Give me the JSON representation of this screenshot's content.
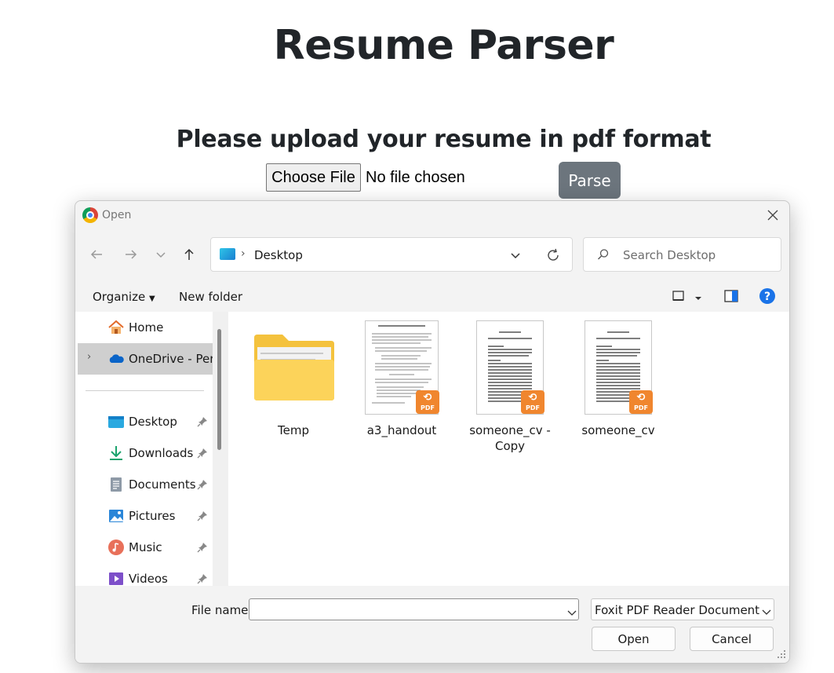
{
  "page": {
    "title": "Resume Parser",
    "upload_heading": "Please upload your resume in pdf format",
    "choose_file_label": "Choose File",
    "no_file_text": "No file chosen",
    "parse_label": "Parse"
  },
  "dialog": {
    "title": "Open",
    "address": {
      "crumb": "Desktop"
    },
    "search": {
      "placeholder": "Search Desktop"
    },
    "toolbar": {
      "organize": "Organize",
      "new_folder": "New folder"
    },
    "sidebar": {
      "home": "Home",
      "onedrive": "OneDrive - Personal",
      "desktop": "Desktop",
      "downloads": "Downloads",
      "documents": "Documents",
      "pictures": "Pictures",
      "music": "Music",
      "videos": "Videos"
    },
    "files": {
      "temp": "Temp",
      "a3": "a3_handout",
      "cv_copy": "someone_cv - Copy",
      "cv": "someone_cv"
    },
    "pdf_badge": "PDF",
    "footer": {
      "file_name_label": "File name:",
      "file_name_value": "",
      "file_type": "Foxit PDF Reader Document",
      "open_label": "Open",
      "cancel_label": "Cancel"
    }
  },
  "colors": {
    "parse_button": "#6c757d",
    "pdf_badge": "#f0862e",
    "help_icon": "#1a73e8",
    "selected_sidebar": "#cfcfcf"
  }
}
